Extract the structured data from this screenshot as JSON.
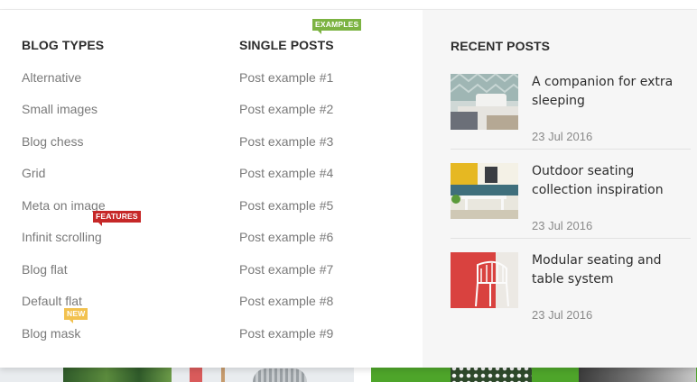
{
  "blog_types": {
    "title": "BLOG TYPES",
    "items": [
      "Alternative",
      "Small images",
      "Blog chess",
      "Grid",
      "Meta on image",
      "Infinit scrolling",
      "Blog flat",
      "Default flat",
      "Blog mask"
    ],
    "badges": {
      "features": "FEATURES",
      "new": "NEW"
    }
  },
  "single_posts": {
    "title": "SINGLE POSTS",
    "badge": "EXAMPLES",
    "items": [
      "Post example #1",
      "Post example #2",
      "Post example #3",
      "Post example #4",
      "Post example #5",
      "Post example #6",
      "Post example #7",
      "Post example #8",
      "Post example #9"
    ]
  },
  "recent_posts": {
    "title": "RECENT POSTS",
    "posts": [
      {
        "title": "A companion for extra sleeping",
        "date": "23 Jul 2016"
      },
      {
        "title": "Outdoor seating collection inspiration",
        "date": "23 Jul 2016"
      },
      {
        "title": "Modular seating and table system",
        "date": "23 Jul 2016"
      }
    ]
  },
  "colors": {
    "badge_examples": "#7cb342",
    "badge_features": "#c62828",
    "badge_new": "#f2c14e"
  }
}
